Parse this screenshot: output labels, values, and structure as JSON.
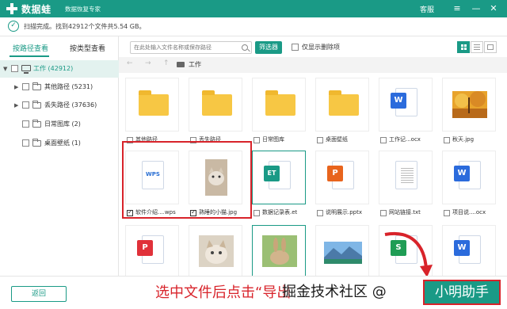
{
  "app": {
    "brand": "数据蛙",
    "subtitle": "数据恢复专家",
    "links": {
      "service": "客服",
      "menu": "≡"
    },
    "window_buttons": {
      "minimize": "—",
      "close": "✕"
    }
  },
  "status": {
    "text": "扫描完成。找到42912个文件共5.54 GB。"
  },
  "tabs": {
    "by_path": "按路径查看",
    "by_type": "按类型查看"
  },
  "tree": {
    "root": "工作 (42912)",
    "items": [
      {
        "label": "其他路径 (5231)",
        "expandable": true
      },
      {
        "label": "丢失路径 (37636)",
        "expandable": true
      },
      {
        "label": "日常图库 (2)",
        "expandable": false
      },
      {
        "label": "桌面壁纸 (1)",
        "expandable": false
      }
    ]
  },
  "toolbar": {
    "search_placeholder": "在此处输入文件名称或保存路径",
    "filter_label": "筛选器",
    "show_deleted_label": "仅显示删除项"
  },
  "breadcrumb": {
    "back": "←",
    "forward": "→",
    "up": "↑",
    "current": "工作"
  },
  "files": [
    {
      "name": "其他路径",
      "kind": "folder",
      "checked": false
    },
    {
      "name": "丢失路径",
      "kind": "folder",
      "checked": false
    },
    {
      "name": "日常图库",
      "kind": "folder",
      "checked": false
    },
    {
      "name": "桌面壁纸",
      "kind": "folder",
      "checked": false
    },
    {
      "name": "工作记...ocx",
      "kind": "word",
      "checked": false
    },
    {
      "name": "秋天.jpg",
      "kind": "image",
      "checked": false
    },
    {
      "name": "软件介绍....wps",
      "kind": "wps",
      "checked": true
    },
    {
      "name": "熟睡的小猫.jpg",
      "kind": "image",
      "checked": true
    },
    {
      "name": "数据记录表.et",
      "kind": "et",
      "checked": false
    },
    {
      "name": "说明展示.pptx",
      "kind": "ppt",
      "checked": false
    },
    {
      "name": "网站链接.txt",
      "kind": "txt",
      "checked": false
    },
    {
      "name": "项目说....ocx",
      "kind": "word",
      "checked": false
    }
  ],
  "file_badges": {
    "word": "W",
    "ppt": "P",
    "et": "ET",
    "wps": "WPS",
    "sheet": "S",
    "pdf": "P"
  },
  "colors": {
    "accent": "#1a9a86",
    "annotation": "#d8232a",
    "word": "#2b6bdc",
    "ppt": "#e8641d",
    "et": "#1a9a86",
    "sheet": "#1f9d55",
    "pdf": "#e0313a",
    "folder": "#f7c744"
  },
  "bottom": {
    "back_label": "返回",
    "instruction": "选中文件后点击“导出",
    "watermark": "掘金技术社区 @",
    "recover_label": "小明助手"
  }
}
